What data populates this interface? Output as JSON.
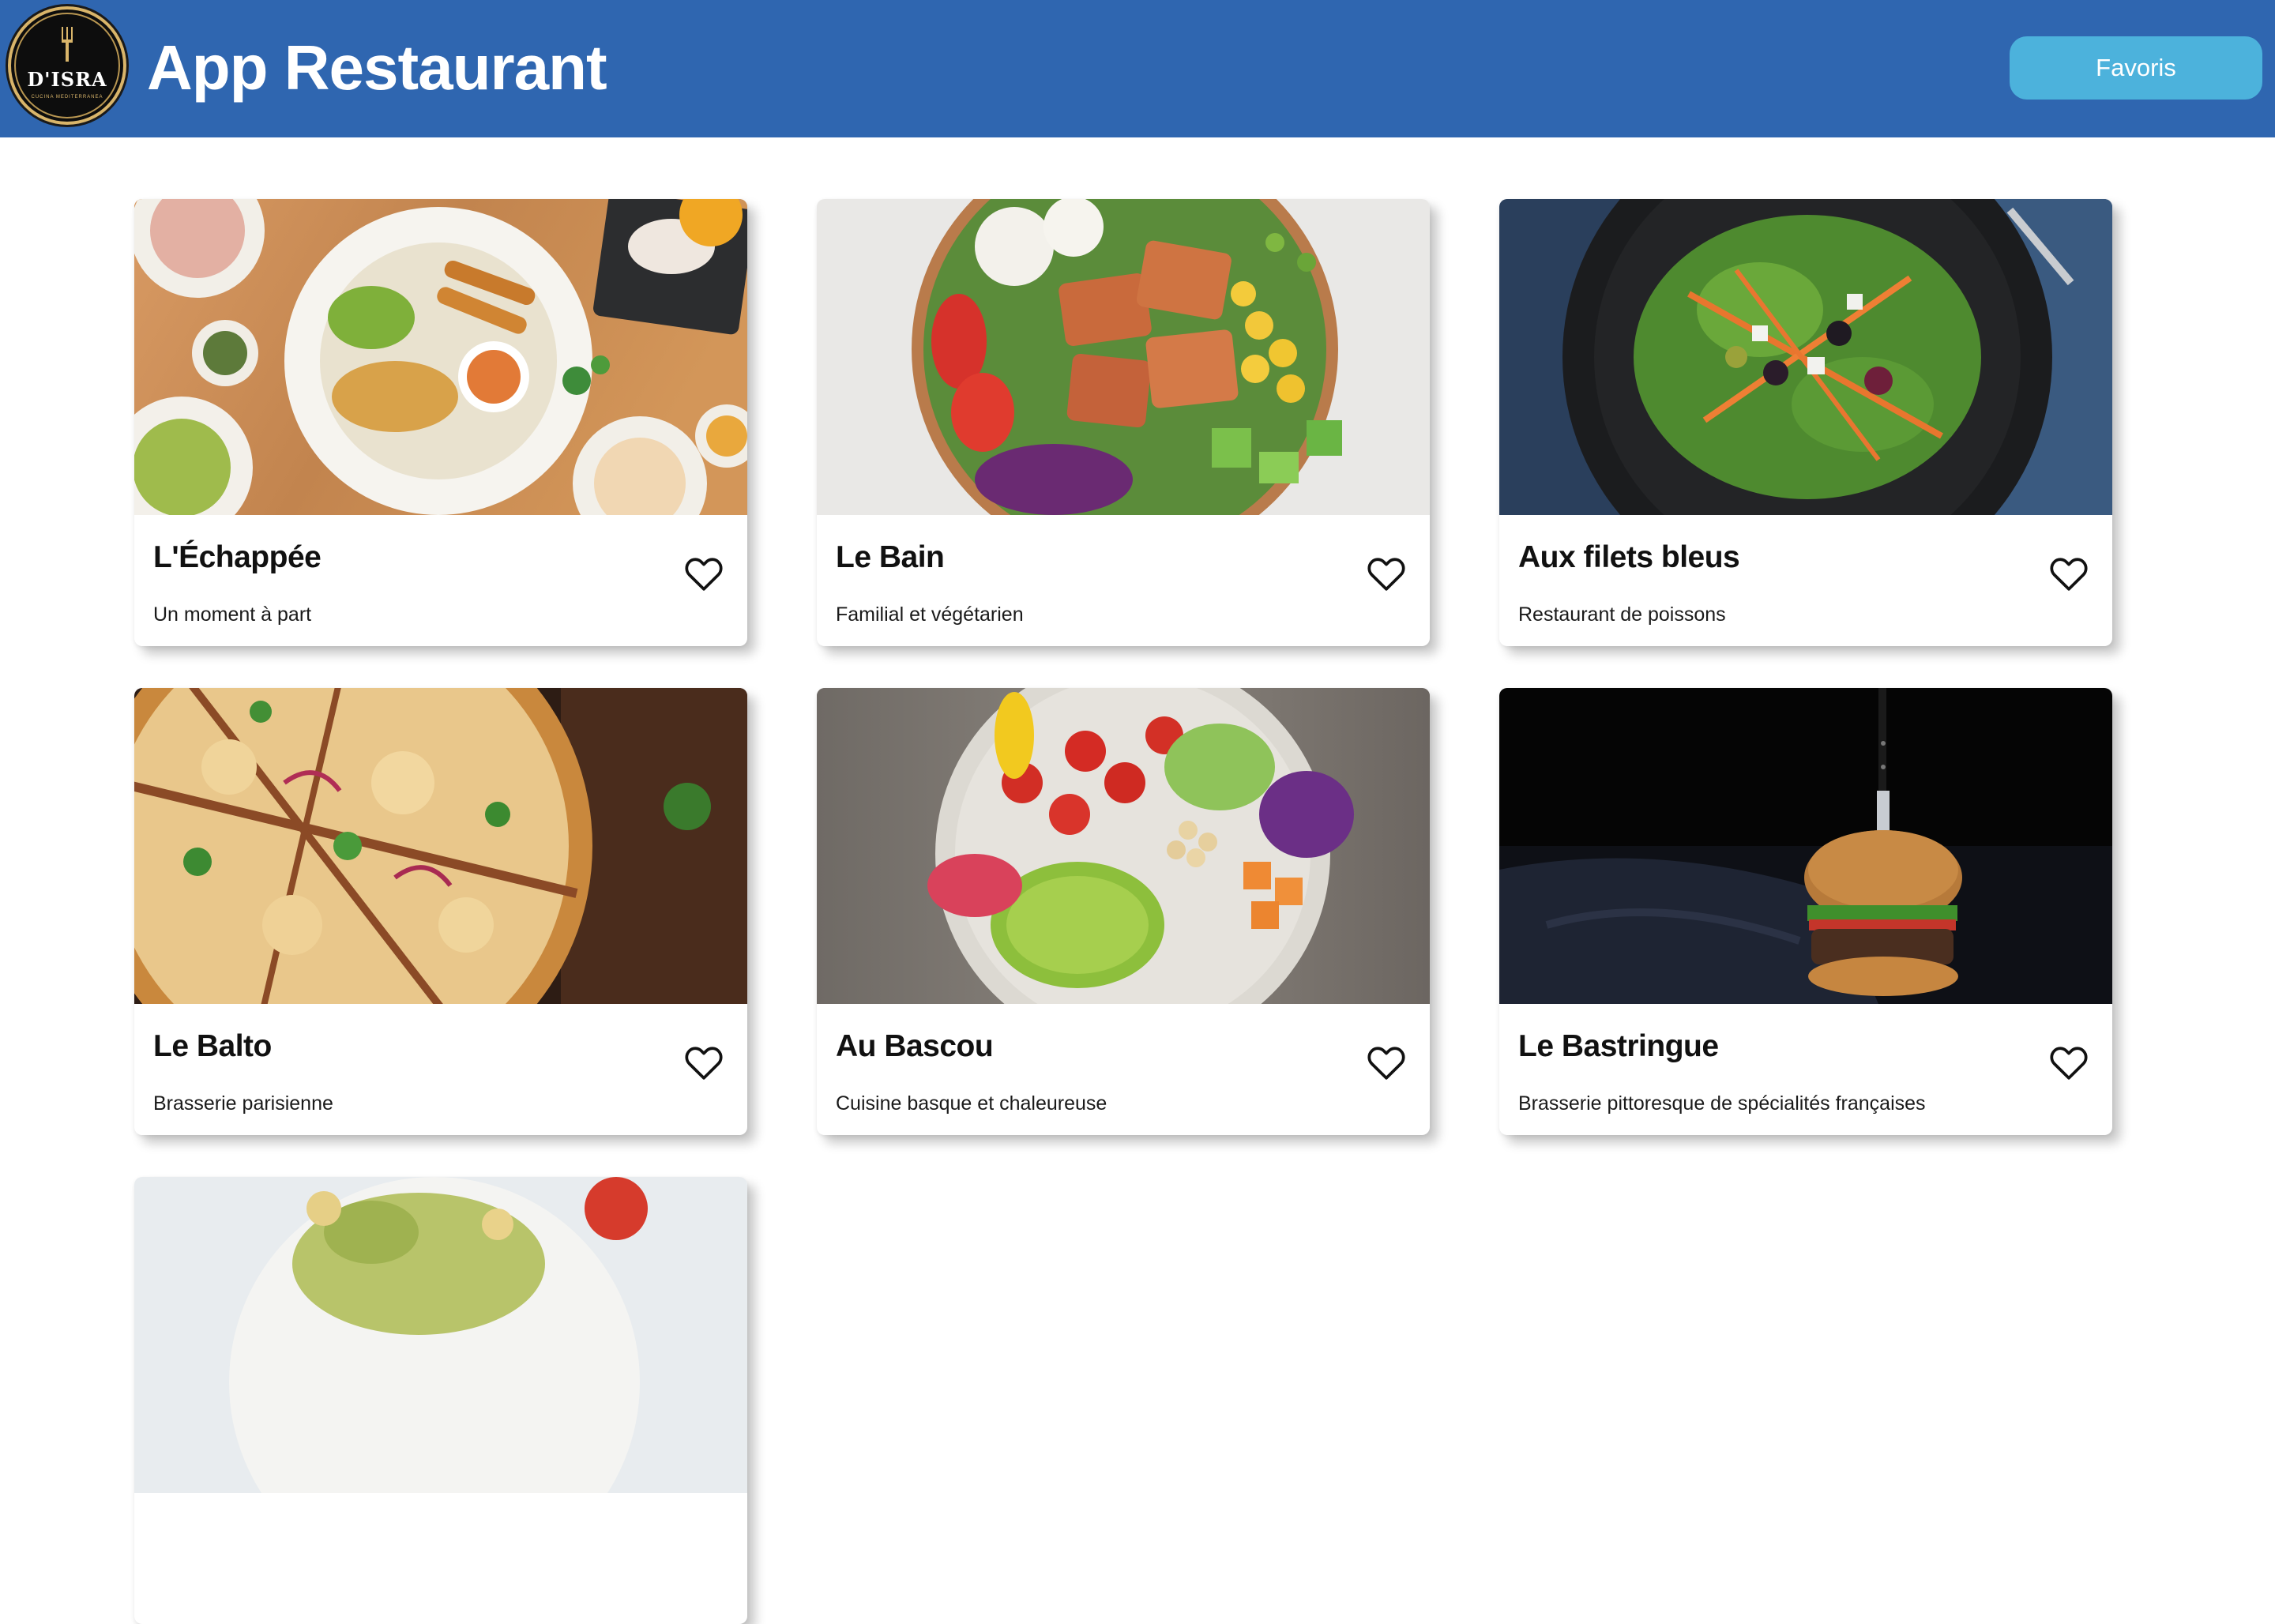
{
  "header": {
    "title": "App Restaurant",
    "favorites_label": "Favoris",
    "logo_name": "D'ISRA",
    "logo_tagline": "CUCINA MEDITERRANEA",
    "background_color": "#2f66b0",
    "button_color": "#4cb2dc"
  },
  "restaurants": [
    {
      "name": "L'Échappée",
      "description": "Un moment à part",
      "image": "asian-noodles-plate-photo",
      "favorite_icon": "heart-outline-icon"
    },
    {
      "name": "Le Bain",
      "description": "Familial et végétarien",
      "image": "tofu-salad-bowl-photo",
      "favorite_icon": "heart-outline-icon"
    },
    {
      "name": "Aux filets bleus",
      "description": "Restaurant de poissons",
      "image": "green-salad-dark-plate-photo",
      "favorite_icon": "heart-outline-icon"
    },
    {
      "name": "Le Balto",
      "description": "Brasserie parisienne",
      "image": "pizza-on-board-photo",
      "favorite_icon": "heart-outline-icon"
    },
    {
      "name": "Au Bascou",
      "description": "Cuisine basque et chaleureuse",
      "image": "veggie-bowl-avocado-photo",
      "favorite_icon": "heart-outline-icon"
    },
    {
      "name": "Le Bastringue",
      "description": "Brasserie pittoresque de spécialités françaises",
      "image": "burger-with-knife-photo",
      "favorite_icon": "heart-outline-icon"
    },
    {
      "name": "",
      "description": "",
      "image": "pasta-salad-photo"
    }
  ]
}
